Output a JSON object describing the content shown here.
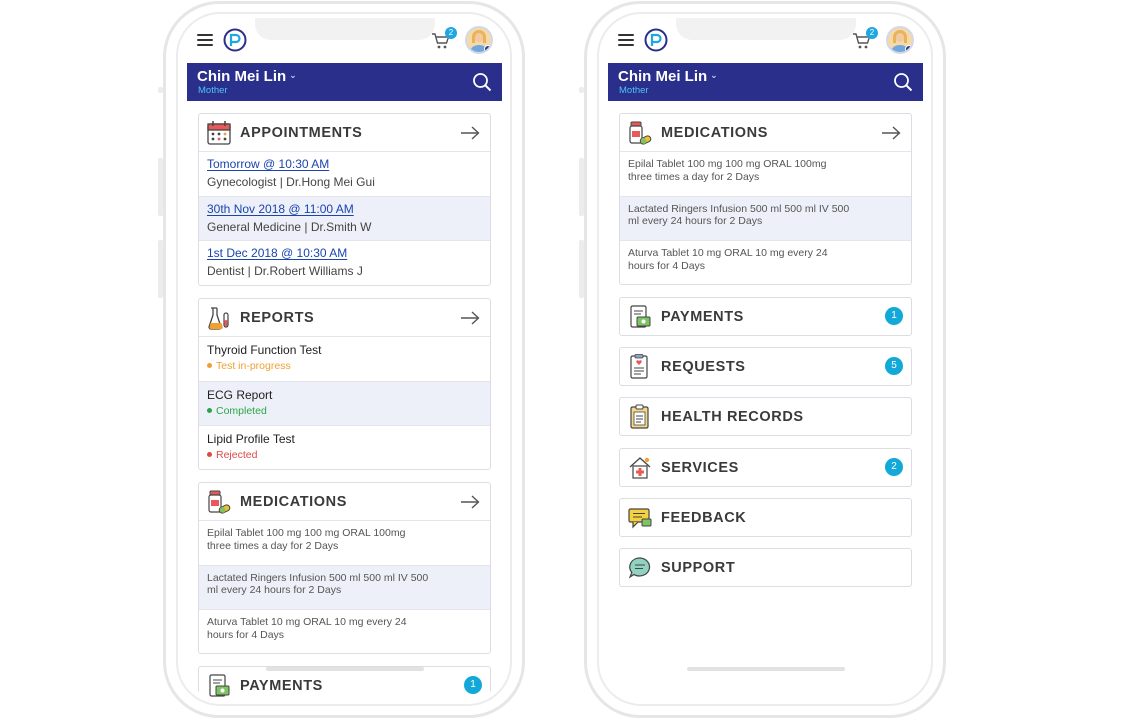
{
  "header": {
    "cart_count": "2",
    "user_name": "Chin Mei Lin",
    "user_role": "Mother"
  },
  "left": {
    "appointments": {
      "title": "APPOINTMENTS",
      "items": [
        {
          "date": "Tomorrow @ 10:30 AM",
          "detail": "Gynecologist | Dr.Hong Mei Gui"
        },
        {
          "date": "30th Nov 2018 @ 11:00 AM",
          "detail": "General Medicine | Dr.Smith W"
        },
        {
          "date": "1st Dec 2018 @ 10:30 AM",
          "detail": "Dentist | Dr.Robert Williams J"
        }
      ]
    },
    "reports": {
      "title": "REPORTS",
      "items": [
        {
          "name": "Thyroid Function Test",
          "status": "Test in-progress",
          "status_color": "#f0a030"
        },
        {
          "name": "ECG Report",
          "status": "Completed",
          "status_color": "#28a745"
        },
        {
          "name": "Lipid Profile Test",
          "status": "Rejected",
          "status_color": "#e04848"
        }
      ]
    },
    "medications": {
      "title": "MEDICATIONS",
      "items": [
        "Epilal Tablet 100 mg 100 mg ORAL 100mg three times a day for 2 Days",
        "Lactated Ringers Infusion 500 ml 500 ml IV 500 ml every 24 hours for 2 Days",
        "Aturva Tablet 10 mg ORAL 10 mg every 24 hours for 4 Days"
      ]
    },
    "payments": {
      "title": "PAYMENTS",
      "count": "1"
    }
  },
  "right": {
    "medications": {
      "title": "MEDICATIONS",
      "items": [
        "Epilal Tablet 100 mg 100 mg ORAL 100mg three times a day for 2 Days",
        "Lactated Ringers Infusion 500 ml 500 ml IV 500 ml every 24 hours for 2 Days",
        "Aturva Tablet 10 mg ORAL 10 mg every 24 hours for 4 Days"
      ]
    },
    "menu": [
      {
        "title": "PAYMENTS",
        "count": "1",
        "icon": "payments-icon"
      },
      {
        "title": "REQUESTS",
        "count": "5",
        "icon": "requests-icon"
      },
      {
        "title": "HEALTH RECORDS",
        "count": "",
        "icon": "health-records-icon"
      },
      {
        "title": "SERVICES",
        "count": "2",
        "icon": "services-icon"
      },
      {
        "title": "FEEDBACK",
        "count": "",
        "icon": "feedback-icon"
      },
      {
        "title": "SUPPORT",
        "count": "",
        "icon": "support-icon"
      }
    ]
  },
  "colors": {
    "brand_navy": "#2a2f8c",
    "role_blue": "#4ec3f5",
    "link_blue": "#1a44b0",
    "badge_blue": "#12a9d8",
    "row_alt": "#eef0f9"
  }
}
